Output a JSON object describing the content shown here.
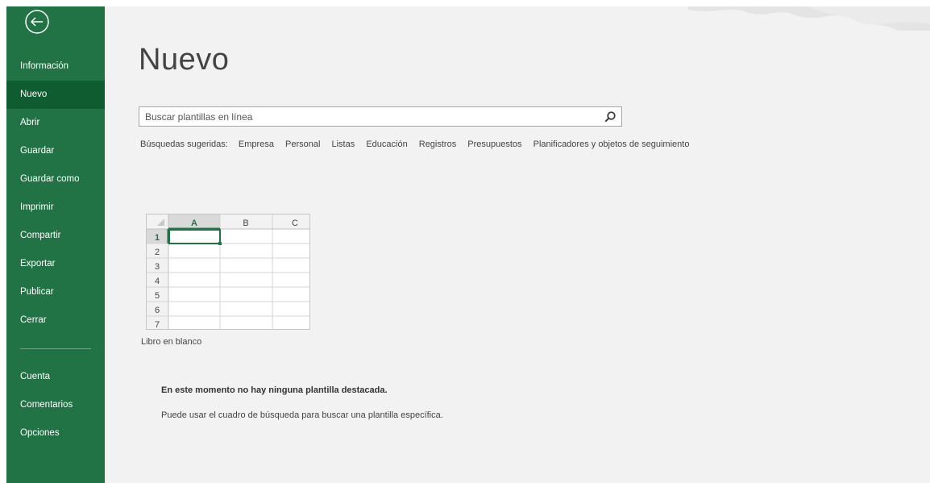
{
  "sidebar": {
    "items": [
      {
        "label": "Información"
      },
      {
        "label": "Nuevo"
      },
      {
        "label": "Abrir"
      },
      {
        "label": "Guardar"
      },
      {
        "label": "Guardar como"
      },
      {
        "label": "Imprimir"
      },
      {
        "label": "Compartir"
      },
      {
        "label": "Exportar"
      },
      {
        "label": "Publicar"
      },
      {
        "label": "Cerrar"
      }
    ],
    "bottom_items": [
      {
        "label": "Cuenta"
      },
      {
        "label": "Comentarios"
      },
      {
        "label": "Opciones"
      }
    ],
    "active": "Nuevo",
    "back_icon": "back-arrow-icon",
    "color": "#217346",
    "active_color": "#0e5c2f"
  },
  "main": {
    "title": "Nuevo",
    "search": {
      "placeholder": "Buscar plantillas en línea",
      "icon": "search-icon"
    },
    "suggested": {
      "label": "Búsquedas sugeridas:",
      "links": [
        "Empresa",
        "Personal",
        "Listas",
        "Educación",
        "Registros",
        "Presupuestos",
        "Planificadores y objetos de seguimiento"
      ]
    },
    "blank_workbook": {
      "label": "Libro en blanco",
      "columns": [
        "A",
        "B",
        "C"
      ],
      "rows": [
        "1",
        "2",
        "3",
        "4",
        "5",
        "6",
        "7"
      ]
    },
    "no_featured": "En este momento no hay ninguna plantilla destacada.",
    "hint": "Puede usar el cuadro de búsqueda para buscar una plantilla específica."
  }
}
